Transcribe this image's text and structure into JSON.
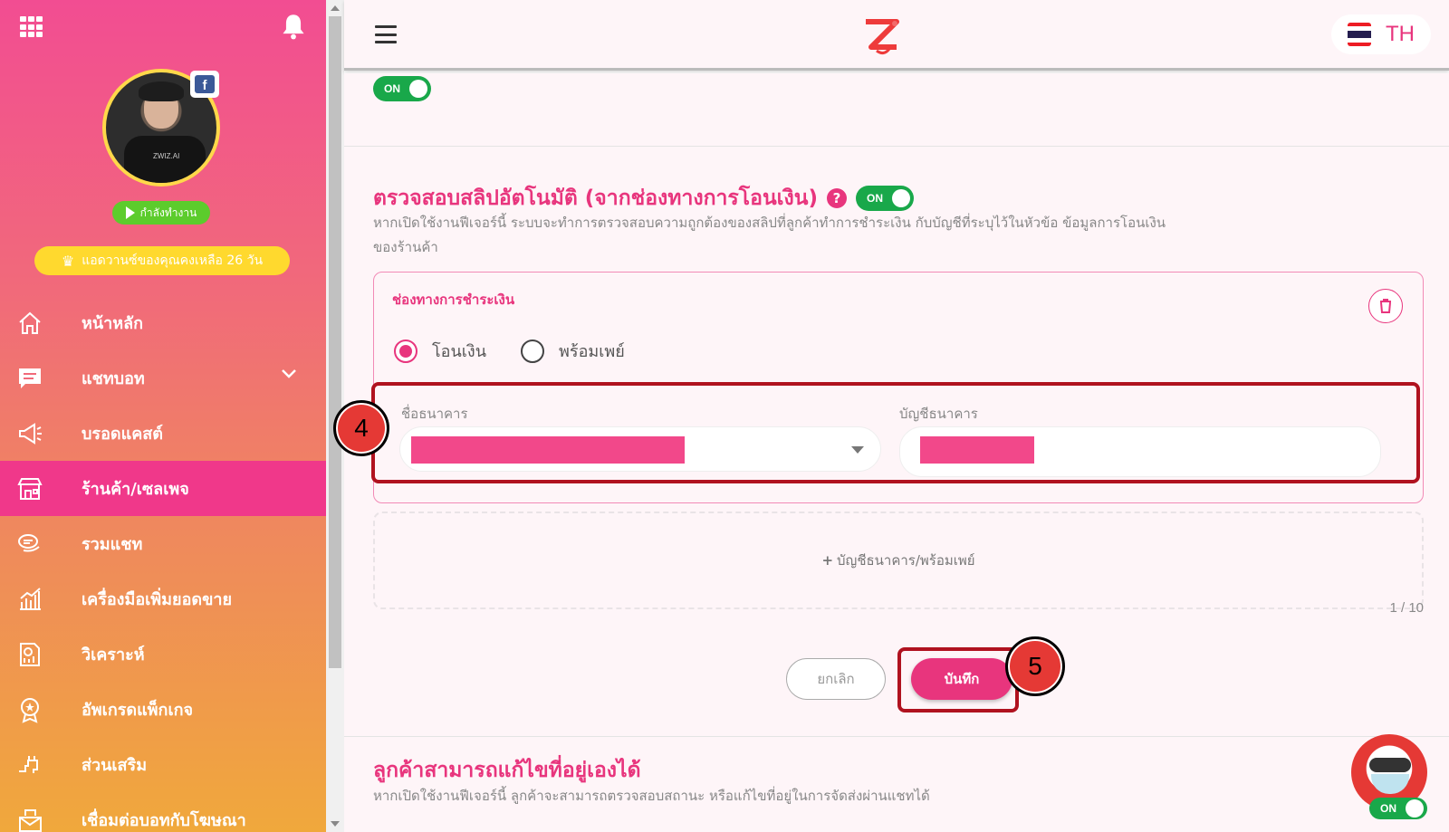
{
  "sidebar": {
    "status_label": "กำลังทำงาน",
    "trial_label": "แอดวานซ์ของคุณคงเหลือ 26 วัน",
    "items": [
      {
        "label": "หน้าหลัก",
        "icon": "home-icon"
      },
      {
        "label": "แชทบอท",
        "icon": "chat-icon"
      },
      {
        "label": "บรอดแคสต์",
        "icon": "megaphone-icon"
      },
      {
        "label": "ร้านค้า/เซลเพจ",
        "icon": "store-icon"
      },
      {
        "label": "รวมแชท",
        "icon": "chats-icon"
      },
      {
        "label": "เครื่องมือเพิ่มยอดขาย",
        "icon": "sales-chart-icon"
      },
      {
        "label": "วิเคราะห์",
        "icon": "analytics-icon"
      },
      {
        "label": "อัพเกรดแพ็กเกจ",
        "icon": "badge-icon"
      },
      {
        "label": "ส่วนเสริม",
        "icon": "plugin-icon"
      },
      {
        "label": "เชื่อมต่อบอทกับโฆษณา",
        "icon": "ads-icon"
      }
    ],
    "active_index": 3
  },
  "topbar": {
    "language": "TH"
  },
  "toggles": {
    "on_label": "ON"
  },
  "slip_section": {
    "title": "ตรวจสอบสลิปอัตโนมัติ (จากช่องทางการโอนเงิน)",
    "description": "หากเปิดใช้งานฟีเจอร์นี้ ระบบจะทำการตรวจสอบความถูกต้องของสลิปที่ลูกค้าทำการชำระเงิน กับบัญชีที่ระบุไว้ในหัวข้อ ข้อมูลการโอนเงิน ของร้านค้า",
    "card": {
      "label": "ช่องทางการชำระเงิน",
      "radio_options": [
        "โอนเงิน",
        "พร้อมเพย์"
      ],
      "selected_option": "โอนเงิน",
      "bank_name_label": "ชื่อธนาคาร",
      "bank_account_label": "บัญชีธนาคาร"
    },
    "add_label": "บัญชีธนาคาร/พร้อมเพย์",
    "counter": "1 / 10",
    "cancel_label": "ยกเลิก",
    "save_label": "บันทึก"
  },
  "steps": {
    "step4": "4",
    "step5": "5"
  },
  "address_section": {
    "title": "ลูกค้าสามารถแก้ไขที่อยู่เองได้",
    "description": "หากเปิดใช้งานฟีเจอร์นี้ ลูกค้าจะสามารถตรวจสอบสถานะ หรือแก้ไขที่อยู่ในการจัดส่งผ่านแชทได้"
  },
  "colors": {
    "brand_pink": "#e8357d",
    "toggle_green": "#19a84a",
    "highlight_red": "#b0121f"
  }
}
